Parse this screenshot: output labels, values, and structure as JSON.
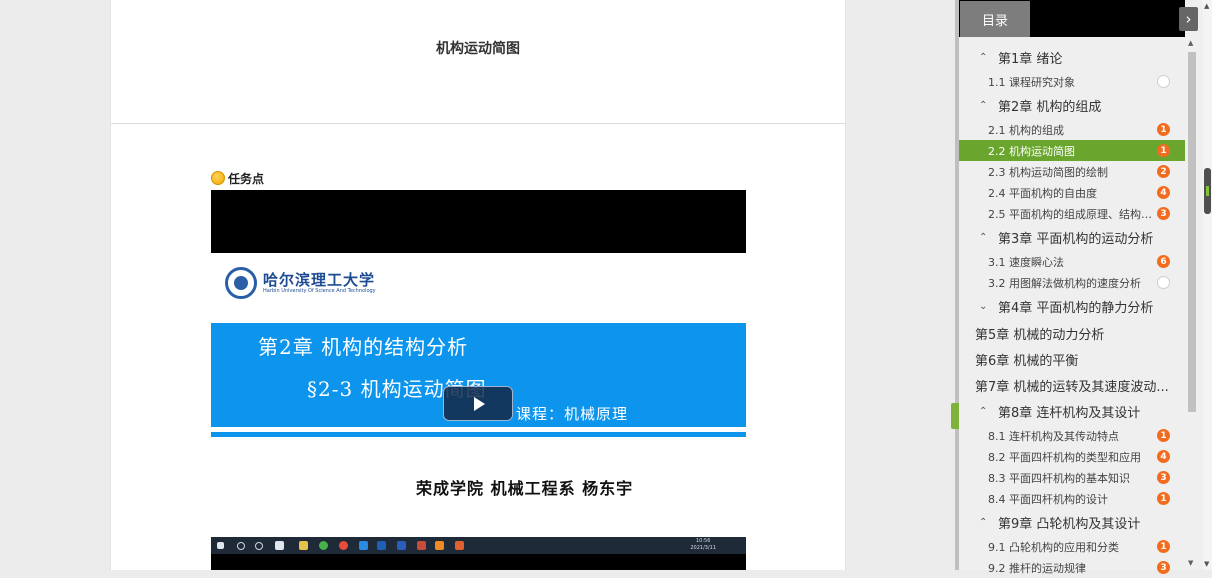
{
  "page": {
    "title": "机构运动简图"
  },
  "task": {
    "label": "任务点"
  },
  "video": {
    "slide": {
      "university_cn": "哈尔滨理工大学",
      "university_en": "Harbin University Of Science And Technology",
      "chapter_title": "第2章  机构的结构分析",
      "section_title": "§2-3   机构运动简图",
      "course": "课程：机械原理",
      "author": "荣成学院  机械工程系   杨东宇"
    },
    "taskbar": {
      "time": "10:56",
      "date": "2021/3/11"
    },
    "play_icon": "play-icon"
  },
  "sidebar": {
    "tab_label": "目录",
    "toggle_icon": "chevron-right-icon",
    "items": [
      {
        "type": "chapter",
        "label": "第1章 绪论",
        "chev": "^"
      },
      {
        "type": "section",
        "label": "1.1 课程研究对象",
        "badge": ""
      },
      {
        "type": "chapter",
        "label": "第2章 机构的组成",
        "chev": "^"
      },
      {
        "type": "section",
        "label": "2.1 机构的组成",
        "badge": "1"
      },
      {
        "type": "section",
        "label": "2.2 机构运动简图",
        "badge": "1",
        "active": true
      },
      {
        "type": "section",
        "label": "2.3 机构运动简图的绘制",
        "badge": "2"
      },
      {
        "type": "section",
        "label": "2.4 平面机构的自由度",
        "badge": "4"
      },
      {
        "type": "section",
        "label": "2.5 平面机构的组成原理、结构分...",
        "badge": "3"
      },
      {
        "type": "chapter",
        "label": "第3章 平面机构的运动分析",
        "chev": "^"
      },
      {
        "type": "section",
        "label": "3.1 速度瞬心法",
        "badge": "6"
      },
      {
        "type": "section",
        "label": "3.2 用图解法做机构的速度分析",
        "badge": ""
      },
      {
        "type": "chapter",
        "label": "第4章 平面机构的静力分析",
        "chev": "v"
      },
      {
        "type": "flat",
        "label": "第5章 机械的动力分析"
      },
      {
        "type": "flat",
        "label": "第6章 机械的平衡"
      },
      {
        "type": "flat",
        "label": "第7章 机械的运转及其速度波动..."
      },
      {
        "type": "chapter",
        "label": "第8章 连杆机构及其设计",
        "chev": "^"
      },
      {
        "type": "section",
        "label": "8.1 连杆机构及其传动特点",
        "badge": "1"
      },
      {
        "type": "section",
        "label": "8.2 平面四杆机构的类型和应用",
        "badge": "4"
      },
      {
        "type": "section",
        "label": "8.3 平面四杆机构的基本知识",
        "badge": "3"
      },
      {
        "type": "section",
        "label": "8.4 平面四杆机构的设计",
        "badge": "1"
      },
      {
        "type": "chapter",
        "label": "第9章 凸轮机构及其设计",
        "chev": "^"
      },
      {
        "type": "section",
        "label": "9.1 凸轮机构的应用和分类",
        "badge": "1"
      },
      {
        "type": "section",
        "label": "9.2 推杆的运动规律",
        "badge": "3"
      }
    ]
  },
  "colors": {
    "accent_green": "#6aa52e",
    "badge_orange": "#f26c20",
    "slide_blue": "#0d95ee"
  }
}
